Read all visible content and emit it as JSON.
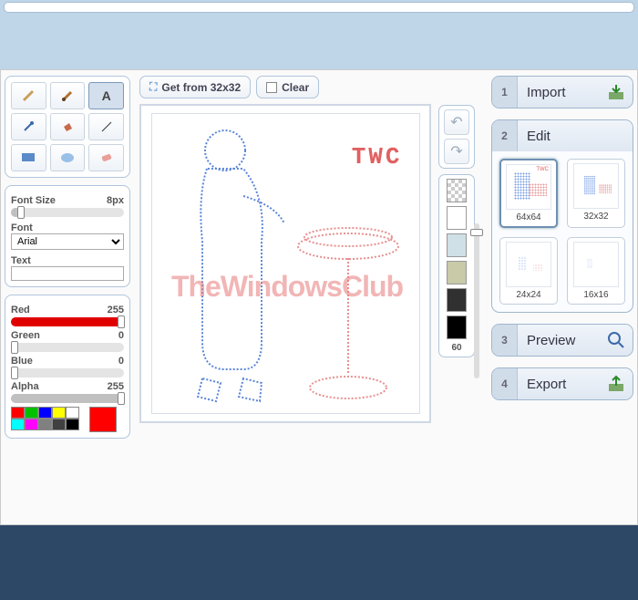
{
  "buttons": {
    "get_from": "Get from 32x32",
    "clear": "Clear"
  },
  "tools": [
    "pencil",
    "brush",
    "text",
    "picker",
    "fill",
    "line",
    "rect",
    "ellipse",
    "eraser"
  ],
  "active_tool": "text",
  "font_panel": {
    "size_label": "Font Size",
    "size_value": "8px",
    "font_label": "Font",
    "font_value": "Arial",
    "text_label": "Text",
    "text_value": ""
  },
  "color_panel": {
    "red": {
      "label": "Red",
      "value": 255
    },
    "green": {
      "label": "Green",
      "value": 0
    },
    "blue": {
      "label": "Blue",
      "value": 0
    },
    "alpha": {
      "label": "Alpha",
      "value": 255
    },
    "swatches": [
      "#ff0000",
      "#00c000",
      "#0000ff",
      "#ffff00",
      "#ffffff",
      "#00ffff",
      "#ff00ff",
      "#808080",
      "#404040",
      "#000000"
    ],
    "current": "#ff0000"
  },
  "canvas": {
    "twc_text": "TWC",
    "bottom_text": "TheWindowsClub"
  },
  "palette_col": [
    "checker",
    "#ffffff",
    "#cfe0e6",
    "#c8caa8",
    "#303030",
    "#000000"
  ],
  "opacity_value": "60",
  "steps": {
    "import": {
      "num": "1",
      "title": "Import"
    },
    "edit": {
      "num": "2",
      "title": "Edit"
    },
    "preview": {
      "num": "3",
      "title": "Preview"
    },
    "export": {
      "num": "4",
      "title": "Export"
    }
  },
  "thumbs": [
    {
      "label": "64x64",
      "active": true
    },
    {
      "label": "32x32",
      "active": false
    },
    {
      "label": "24x24",
      "active": false
    },
    {
      "label": "16x16",
      "active": false
    }
  ]
}
